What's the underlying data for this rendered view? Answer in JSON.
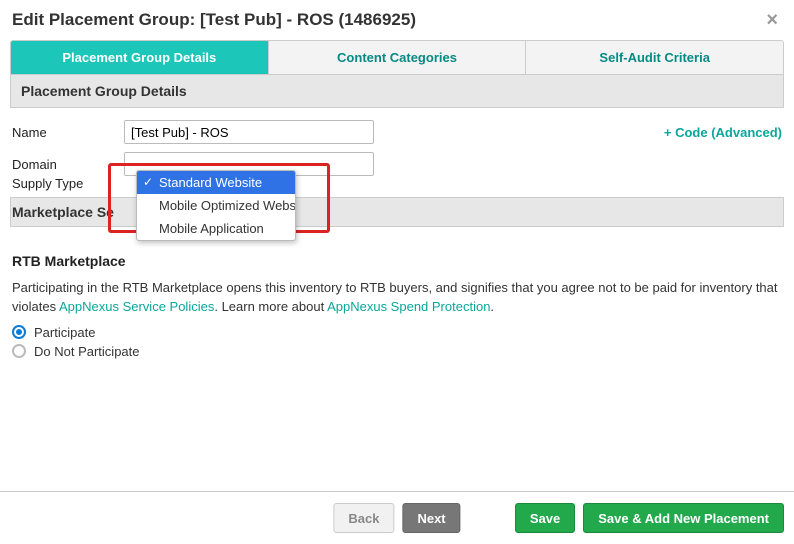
{
  "modal": {
    "title": "Edit Placement Group: [Test Pub] - ROS (1486925)"
  },
  "tabs": {
    "details": "Placement Group Details",
    "content": "Content Categories",
    "audit": "Self-Audit Criteria"
  },
  "section": {
    "heading": "Placement Group Details",
    "marketplace_heading": "Marketplace Se"
  },
  "form": {
    "name_label": "Name",
    "name_value": "[Test Pub] - ROS",
    "domain_label": "Domain",
    "domain_value": "",
    "supply_label": "Supply Type",
    "code_link": "+ Code (Advanced)"
  },
  "supply_dropdown": {
    "options": {
      "standard": "Standard Website",
      "mobile_web": "Mobile Optimized Website",
      "mobile_app": "Mobile Application"
    }
  },
  "rtb": {
    "heading": "RTB Marketplace",
    "text1": "Participating in the RTB Marketplace opens this inventory to RTB buyers, and signifies that you agree not to be paid for inventory that violates ",
    "link1": "AppNexus Service Policies",
    "text2": ". Learn more about ",
    "link2": "AppNexus Spend Protection",
    "text3": ".",
    "participate": "Participate",
    "no_participate": "Do Not Participate"
  },
  "footer": {
    "back": "Back",
    "next": "Next",
    "save": "Save",
    "save_add": "Save & Add New Placement"
  }
}
